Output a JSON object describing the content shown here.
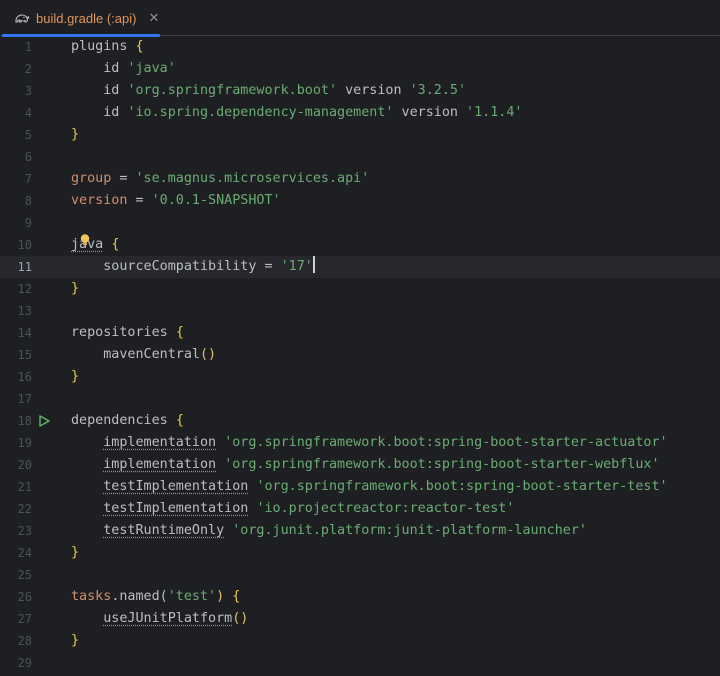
{
  "tab": {
    "icon": "gradle-elephant-icon",
    "title": "build.gradle (:api)",
    "close_icon": "close-icon"
  },
  "colors": {
    "background": "#1e1f22",
    "keyword": "#cf8e6d",
    "string": "#6aab73",
    "brace": "#e8c94a",
    "text": "#bcbec4",
    "active_tab_underline": "#3574f0"
  },
  "current_line": 11,
  "lines": [
    {
      "n": "1",
      "t": [
        "plugins",
        " ",
        "{"
      ]
    },
    {
      "n": "2",
      "t": [
        "    id ",
        "'java'"
      ]
    },
    {
      "n": "3",
      "t": [
        "    id ",
        "'org.springframework.boot'",
        " version ",
        "'3.2.5'"
      ]
    },
    {
      "n": "4",
      "t": [
        "    id ",
        "'io.spring.dependency-management'",
        " version ",
        "'1.1.4'"
      ]
    },
    {
      "n": "5",
      "t": [
        "}"
      ]
    },
    {
      "n": "6",
      "t": []
    },
    {
      "n": "7",
      "t": [
        "group",
        " = ",
        "'se.magnus.microservices.api'"
      ]
    },
    {
      "n": "8",
      "t": [
        "version",
        " = ",
        "'0.0.1-SNAPSHOT'"
      ]
    },
    {
      "n": "9",
      "t": []
    },
    {
      "n": "10",
      "t": [
        "java",
        " ",
        "{"
      ]
    },
    {
      "n": "11",
      "t": [
        "    sourceCompatibility = ",
        "'17'"
      ]
    },
    {
      "n": "12",
      "t": [
        "}"
      ]
    },
    {
      "n": "13",
      "t": []
    },
    {
      "n": "14",
      "t": [
        "repositories",
        " ",
        "{"
      ]
    },
    {
      "n": "15",
      "t": [
        "    mavenCentral",
        "()"
      ]
    },
    {
      "n": "16",
      "t": [
        "}"
      ]
    },
    {
      "n": "17",
      "t": []
    },
    {
      "n": "18",
      "t": [
        "dependencies",
        " ",
        "{"
      ]
    },
    {
      "n": "19",
      "t": [
        "    ",
        "implementation",
        " ",
        "'org.springframework.boot:spring-boot-starter-actuator'"
      ]
    },
    {
      "n": "20",
      "t": [
        "    ",
        "implementation",
        " ",
        "'org.springframework.boot:spring-boot-starter-webflux'"
      ]
    },
    {
      "n": "21",
      "t": [
        "    ",
        "testImplementation",
        " ",
        "'org.springframework.boot:spring-boot-starter-test'"
      ]
    },
    {
      "n": "22",
      "t": [
        "    ",
        "testImplementation",
        " ",
        "'io.projectreactor:reactor-test'"
      ]
    },
    {
      "n": "23",
      "t": [
        "    ",
        "testRuntimeOnly",
        " ",
        "'org.junit.platform:junit-platform-launcher'"
      ]
    },
    {
      "n": "24",
      "t": [
        "}"
      ]
    },
    {
      "n": "25",
      "t": []
    },
    {
      "n": "26",
      "t": [
        "tasks",
        ".named(",
        "'test'",
        ")",
        " ",
        "{"
      ]
    },
    {
      "n": "27",
      "t": [
        "    ",
        "useJUnitPlatform",
        "()"
      ]
    },
    {
      "n": "28",
      "t": [
        "}"
      ]
    },
    {
      "n": "29",
      "t": []
    }
  ]
}
